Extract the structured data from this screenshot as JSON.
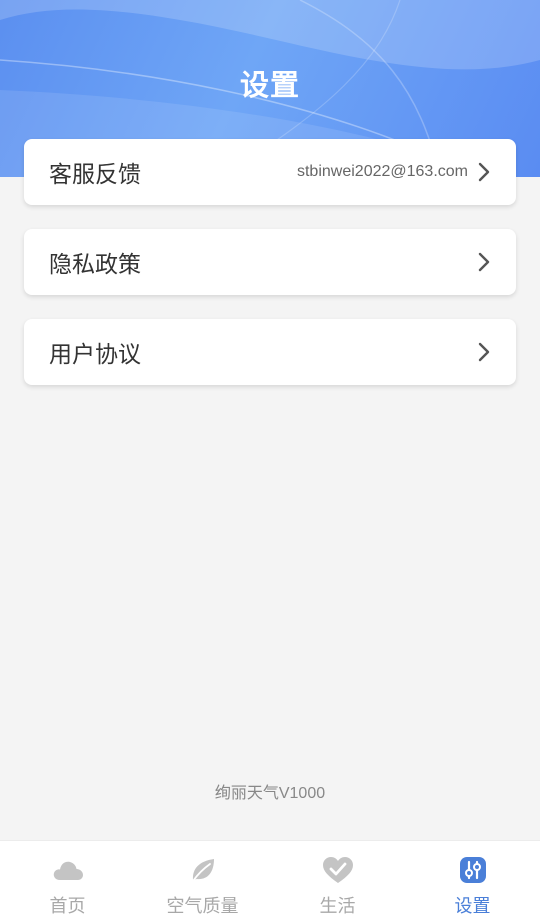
{
  "header": {
    "title": "设置"
  },
  "menu": [
    {
      "label": "客服反馈",
      "value": "stbinwei2022@163.com"
    },
    {
      "label": "隐私政策",
      "value": ""
    },
    {
      "label": "用户协议",
      "value": ""
    }
  ],
  "footer": {
    "version": "绚丽天气V1000"
  },
  "tabs": [
    {
      "label": "首页",
      "icon": "cloud-icon",
      "active": false
    },
    {
      "label": "空气质量",
      "icon": "leaf-icon",
      "active": false
    },
    {
      "label": "生活",
      "icon": "heart-check-icon",
      "active": false
    },
    {
      "label": "设置",
      "icon": "settings-sliders-icon",
      "active": true
    }
  ],
  "colors": {
    "accent": "#4a7fd8",
    "header": "#5b8ff0",
    "inactive": "#a8a8a8",
    "background": "#f4f4f4"
  }
}
